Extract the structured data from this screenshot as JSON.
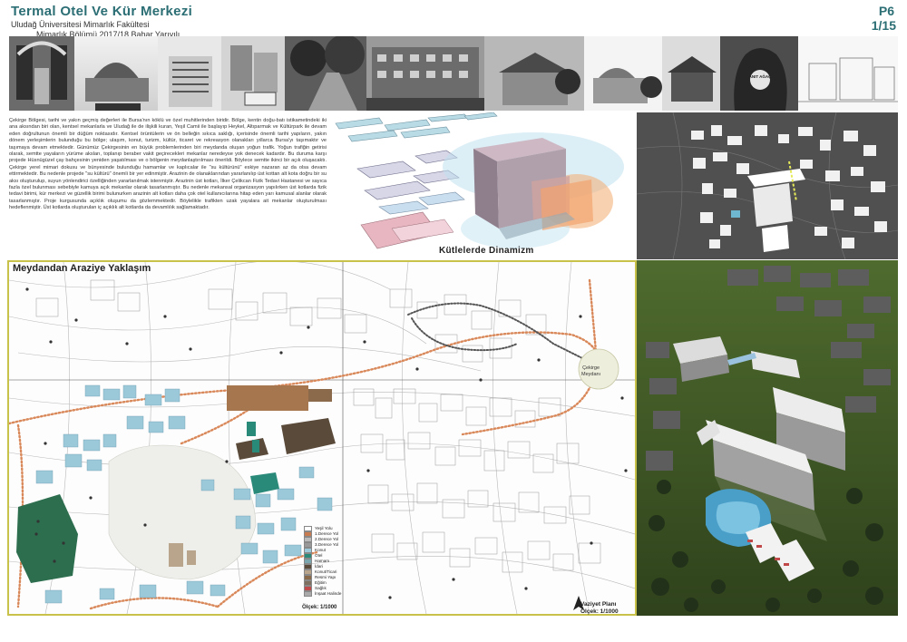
{
  "header": {
    "title": "Termal Otel Ve Kür Merkezi",
    "line1": "Uludağ Üniversitesi Mimarlık Fakültesi",
    "line2": "Mimarlık Bölümü 2017/18 Bahar Yarıyılı",
    "page_code": "P6",
    "page_number": "1/15"
  },
  "intro_text": "Çekirge Bölgesi, tarihi ve yakın geçmiş değerleri ile Bursa'nın köklü ve özel muhitlerinden biridir. Bölge, kentin doğu-batı istikametindeki iki ana aksından biri olan, kentsel mekanlarla ve Uludağ ile de ilişkili kuran, Yeşil Camii ile başlayıp Heykel, Altıparmak ve Kültürpark ile devam eden doğrultunun önemli bir düğüm noktasıdır. Kentsel örüntülerin ve ön belleğin sıkıca saklığı, içerisinde önemli tarihi yapıların, yakın dönem yerleşimlerin bulunduğu bu bölge; ulaşım, konut, turizm, kültür, ticaret ve rekreasyon olanakları yıllarca Bursa'yı taşımaktır ve taşımaya devam etmektedir. Günümüz Çekirgesinin en büyük problemlerinden biri meydanda oluşan yoğun trafik. Yoğun trafiğin getirisi olarak, semtte yayaların yürüme aksları, toplanıp beraber vakit geçirecekleri mekanlar neredeyse yok denecek kadardır. Bu duruma karşı projede Hüsnügüzel çay bahçesinin yeniden yaşatılması ve o bölgenin meydanlaştırılması önerildi. Böylece semtte ikinci bir açık oluşacaktı. Çekirge yerel mimari dokusu ve bünyesinde bulunduğu hamamlar ve kaplıcalar ile \"su kültürünü\" eskiye nazaran az da olsa devam ettirmektedir. Bu nedenle projede \"su kültürü\" önemli bir yer edinmiştir. Arazinin de olanaklarından yararlanılıp üst kottan alt kota doğru bir su aksı oluşturulup, suyun yönlendirici özelliğinden yararlanılmak istenmiştir. Arazinin üst kotları, İlker Çelikcan Fizik Tedavi Hastanesi ve sayıca fazla özel bulunması sebebiyle kamuya açık mekanlar olarak tasarlanmıştır. Bu nedenle mekansal organizasyon yapılırken üst kotlarda fizik tedavi birimi, kür merkezi ve güzellik birimi bulunurken arazinin alt kotları daha çok otel kullanıcılarına hitap eden yarı kamusal alanlar olarak tasarlanmıştır. Proje kurgusunda açıklık oluşumu da gözlemmektedir. Böylelikle trafikten uzak yayalara ait mekanlar oluşturulması hedeflenmiştir. Üst kotlarda oluşturulan iç açıklık alt kotlarda da devamlılık sağlamaktadır.",
  "massing_label": "Kütlelerde Dinamizm",
  "plan": {
    "title": "Meydandan Araziye Yaklaşım",
    "square_label_1": "Çekirge",
    "square_label_2": "Meydanı",
    "scale": "Ölçek: 1/1000",
    "site_plan": "Vaziyet Planı",
    "site_scale": "Ölçek: 1/1000"
  },
  "legend": [
    {
      "label": "Yeşil Yolu",
      "color": "#ffffff"
    },
    {
      "label": "1.Derece Yol",
      "color": "#c77b4e"
    },
    {
      "label": "2.Derece Yol",
      "color": "#bbbbbb"
    },
    {
      "label": "3.Derece Yol",
      "color": "#999999"
    },
    {
      "label": "Konut",
      "color": "#9cc9d9"
    },
    {
      "label": "Otel",
      "color": "#2a8a7a"
    },
    {
      "label": "Hamam",
      "color": "#7aa6b0"
    },
    {
      "label": "İdari",
      "color": "#5a4a3a"
    },
    {
      "label": "Konut/Ticari",
      "color": "#b9a48c"
    },
    {
      "label": "Resmi Yapı",
      "color": "#8b6a4a"
    },
    {
      "label": "Eğitim",
      "color": "#7f6f5f"
    },
    {
      "label": "Sağlık",
      "color": "#c04a4a"
    },
    {
      "label": "İnşaat Halinde",
      "color": "#aaaaaa"
    }
  ],
  "ant_agac": "ANIT AĞAÇ",
  "colors": {
    "accent": "#2b6e74",
    "frame": "#c9c24a",
    "path": "#d9885a"
  }
}
